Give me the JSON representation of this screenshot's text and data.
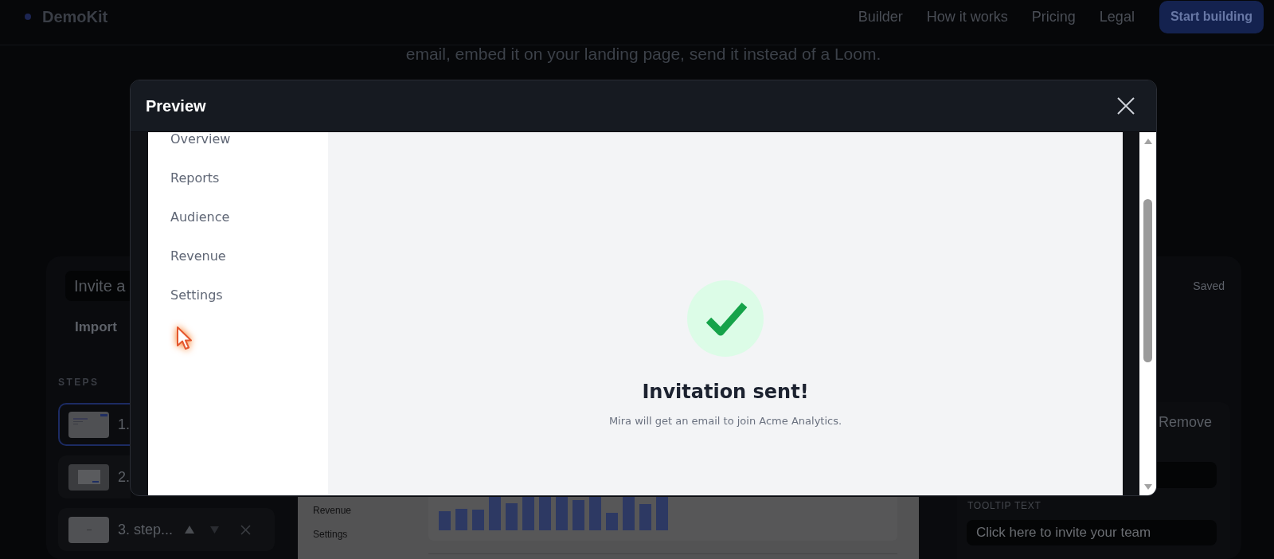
{
  "nav": {
    "logo": "DemoKit",
    "links": [
      {
        "label": "Builder"
      },
      {
        "label": "How it works"
      },
      {
        "label": "Pricing"
      },
      {
        "label": "Legal"
      }
    ],
    "cta": "Start building"
  },
  "hero": {
    "subtitle": "email, embed it on your landing page, send it instead of a Loom."
  },
  "builder": {
    "title_field": {
      "value": "Invite a"
    },
    "status": "Saved",
    "import_button": "Import",
    "steps_label": "STEPS",
    "steps": [
      {
        "label": "1.",
        "kind": "dashboard",
        "selected": true,
        "actions_shown": false
      },
      {
        "label": "2.",
        "kind": "dialog",
        "selected": false,
        "actions_shown": false
      },
      {
        "label": "3. step...",
        "kind": "blank",
        "selected": false,
        "actions_shown": true
      }
    ],
    "screen_preview": {
      "nav_items": [
        "Revenue",
        "Settings"
      ]
    },
    "inspector": {
      "remove_button": "Remove",
      "tooltip_label": "TOOLTIP TEXT",
      "tooltip_field": {
        "value": "Click here to invite your team"
      }
    }
  },
  "preview_modal": {
    "title": "Preview",
    "sidebar_items": [
      {
        "label": "Overview"
      },
      {
        "label": "Reports"
      },
      {
        "label": "Audience"
      },
      {
        "label": "Revenue"
      },
      {
        "label": "Settings"
      }
    ],
    "success": {
      "title": "Invitation sent!",
      "message": "Mira will get an email to join Acme Analytics."
    }
  }
}
